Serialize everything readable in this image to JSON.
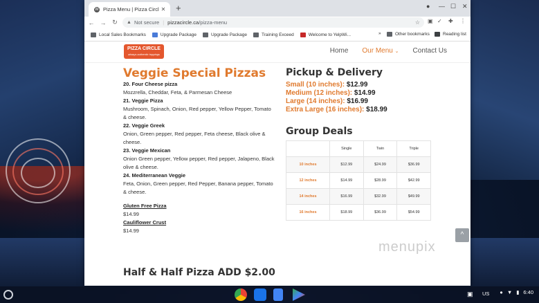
{
  "browser": {
    "tab_title": "Pizza Menu | Pizza Circle",
    "tab_favicon": "wordpress-icon",
    "address": {
      "security": "Not secure",
      "host": "pizzacircle.ca",
      "path": "/pizza-menu"
    },
    "bookmarks": [
      "Local Sales Bookmarks",
      "Upgrade Package",
      "Upgrade Package",
      "Training Exceed",
      "Welcome to YelpWi..."
    ],
    "bookmarks_overflow": "»",
    "other_bookmarks": "Other bookmarks",
    "reading_list": "Reading list"
  },
  "site": {
    "logo_text": "PIZZA CIRCLE",
    "logo_tagline": "always authentic toppings",
    "nav": [
      {
        "label": "Home",
        "active": false
      },
      {
        "label": "Our Menu",
        "active": true
      },
      {
        "label": "Contact Us",
        "active": false
      }
    ]
  },
  "menu": {
    "heading": "Veggie Special Pizzas",
    "pizzas": [
      {
        "name": "20. Four Cheese pizza",
        "desc": "Mozzrella, Cheddar, Feta, & Parmesan Cheese"
      },
      {
        "name": "21. Veggie Pizza",
        "desc": "Mushroom, Spinach, Onion, Red pepper, Yellow Pepper, Tomato",
        "desc2": "& cheese."
      },
      {
        "name": "22. Veggie Greek",
        "desc": "Onion, Green pepper, Red pepper, Feta cheese, Black olive & cheese."
      },
      {
        "name": "23. Veggie Mexican",
        "desc": "Onion Green pepper, Yellow pepper, Red pepper, Jalapeno, Black olive & cheese."
      },
      {
        "name": "24. Mediterranean Veggie",
        "desc": "Feta, Onion, Green pepper, Red Pepper, Banana pepper, Tomato",
        "desc2": "& cheese."
      }
    ],
    "extras": [
      {
        "name": "Gluten Free Pizza",
        "price": "$14.99"
      },
      {
        "name": "Cauliflower Crust",
        "price": "$14.99"
      }
    ],
    "half_and_half": "Half & Half Pizza ADD $2.00"
  },
  "pickup": {
    "heading": "Pickup & Delivery",
    "prices": [
      {
        "label": "Small (10 inches):",
        "price": "$12.99"
      },
      {
        "label": "Medium (12 inches):",
        "price": "$14.99"
      },
      {
        "label": "Large (14 inches):",
        "price": "$16.99"
      },
      {
        "label": "Extra Large (16 inches):",
        "price": "$18.99"
      }
    ]
  },
  "group_deals": {
    "heading": "Group Deals",
    "columns": [
      "",
      "Single",
      "Twin",
      "Triple"
    ],
    "rows": [
      [
        "10 inches",
        "$12.99",
        "$24.99",
        "$36.99"
      ],
      [
        "12 inches",
        "$14.99",
        "$28.99",
        "$42.99"
      ],
      [
        "14 inches",
        "$16.99",
        "$32.99",
        "$49.99"
      ],
      [
        "16 inches",
        "$18.99",
        "$36.99",
        "$54.99"
      ]
    ]
  },
  "watermark": "menupix",
  "shelf": {
    "apps": [
      "chrome-icon",
      "files-icon",
      "docs-icon",
      "play-store-icon"
    ],
    "locale": "US",
    "time": "6:40"
  },
  "colors": {
    "accent": "#e07a2e",
    "logo": "#e4572e"
  }
}
